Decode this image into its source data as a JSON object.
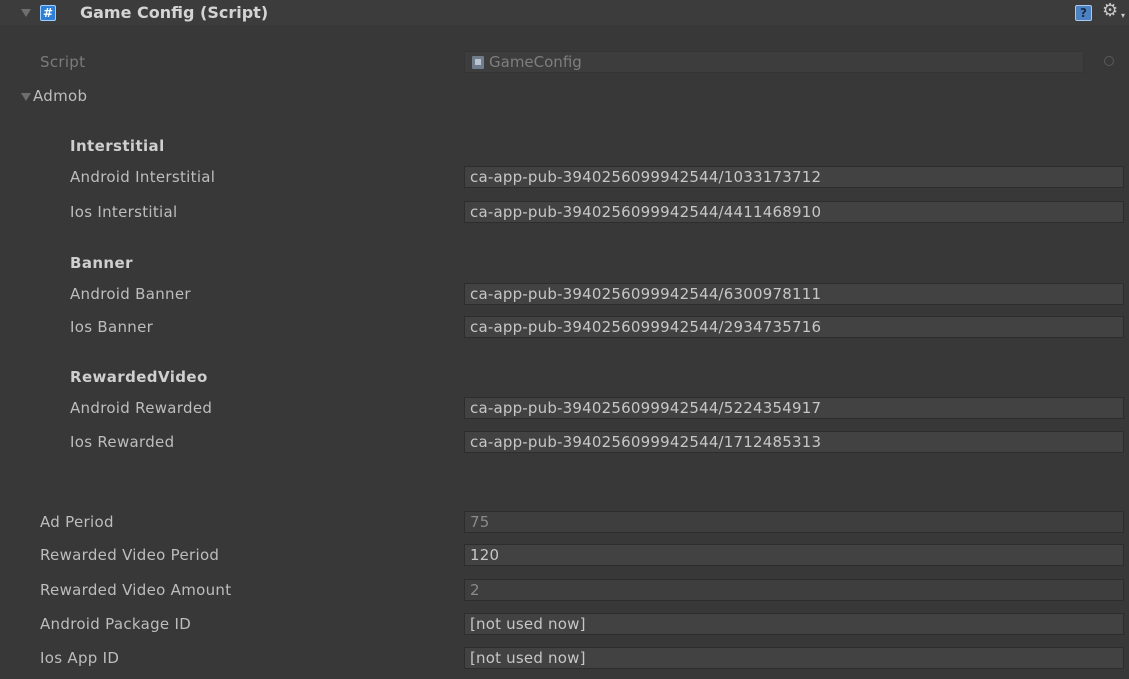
{
  "component": {
    "title": "Game Config (Script)",
    "icon": "csharp-script-icon"
  },
  "script_row": {
    "label": "Script",
    "value": "GameConfig"
  },
  "admob": {
    "label": "Admob",
    "sections": [
      {
        "title": "Interstitial",
        "fields": [
          {
            "label": "Android Interstitial",
            "value": "ca-app-pub-3940256099942544/1033173712"
          },
          {
            "label": "Ios Interstitial",
            "value": "ca-app-pub-3940256099942544/4411468910"
          }
        ]
      },
      {
        "title": "Banner",
        "fields": [
          {
            "label": "Android Banner",
            "value": "ca-app-pub-3940256099942544/6300978111"
          },
          {
            "label": "Ios Banner",
            "value": "ca-app-pub-3940256099942544/2934735716"
          }
        ]
      },
      {
        "title": "RewardedVideo",
        "fields": [
          {
            "label": "Android Rewarded",
            "value": "ca-app-pub-3940256099942544/5224354917"
          },
          {
            "label": "Ios Rewarded",
            "value": "ca-app-pub-3940256099942544/1712485313"
          }
        ]
      }
    ]
  },
  "settings": [
    {
      "label": "Ad Period",
      "value": "75"
    },
    {
      "label": "Rewarded Video Period",
      "value": "120"
    },
    {
      "label": "Rewarded Video Amount",
      "value": "2"
    },
    {
      "label": "Android Package ID",
      "value": "[not used now]"
    },
    {
      "label": "Ios App ID",
      "value": "[not used now]"
    }
  ]
}
